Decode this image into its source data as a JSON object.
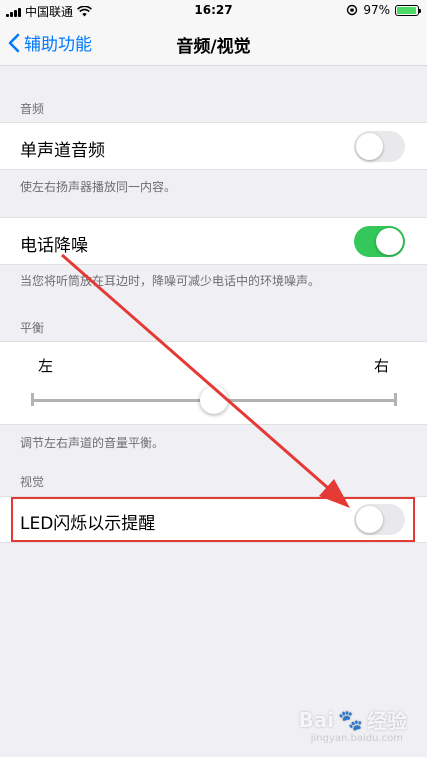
{
  "status_bar": {
    "carrier": "中国联通",
    "time": "16:27",
    "battery": "97%"
  },
  "nav": {
    "back_label": "辅助功能",
    "title": "音频/视觉"
  },
  "sections": {
    "audio": {
      "header": "音频",
      "mono_audio": {
        "label": "单声道音频",
        "on": false
      },
      "mono_footer": "使左右扬声器播放同一内容。",
      "noise_cancel": {
        "label": "电话降噪",
        "on": true
      },
      "noise_footer": "当您将听筒放在耳边时，降噪可减少电话中的环境噪声。"
    },
    "balance": {
      "header": "平衡",
      "left_label": "左",
      "right_label": "右",
      "value": 0.5,
      "footer": "调节左右声道的音量平衡。"
    },
    "visual": {
      "header": "视觉",
      "led_flash": {
        "label": "LED闪烁以示提醒",
        "on": false
      }
    }
  },
  "watermark": {
    "brand": "Bai",
    "brand_cn": "经验",
    "url": "jingyan.baidu.com"
  },
  "colors": {
    "accent": "#007aff",
    "toggle_on": "#34c759",
    "annotation": "#e53935"
  }
}
